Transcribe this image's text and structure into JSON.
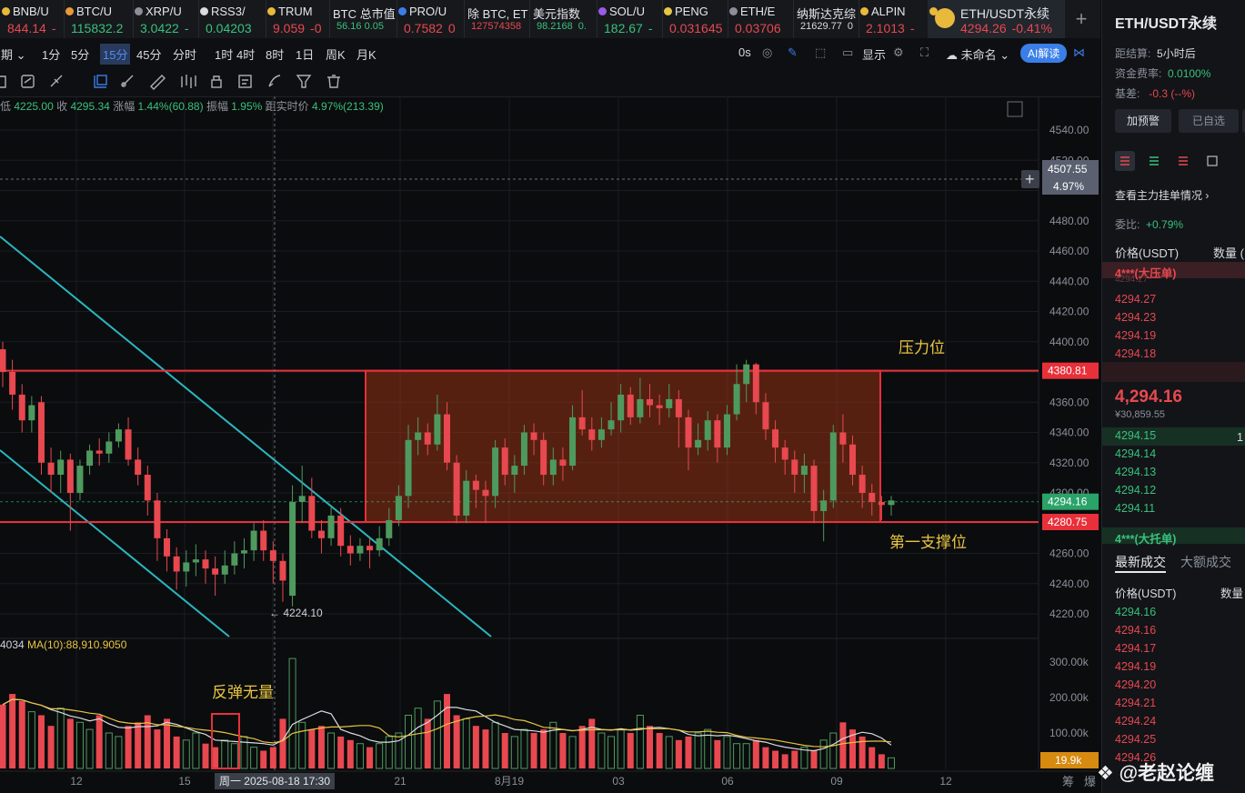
{
  "tickers": [
    {
      "name": "BNB/U",
      "price": "844.14",
      "change": "-",
      "color": "#e8484f",
      "dot": "#e8b93a"
    },
    {
      "name": "BTC/U",
      "price": "115832.2",
      "change": "",
      "color": "#39c17c",
      "dot": "#e89a3a"
    },
    {
      "name": "XRP/U",
      "price": "3.0422",
      "change": "-",
      "color": "#39c17c",
      "dot": "#8a8f98"
    },
    {
      "name": "RSS3/",
      "price": "0.04203",
      "change": "",
      "color": "#39c17c",
      "dot": "#d8dbe0"
    },
    {
      "name": "TRUM",
      "price": "9.059",
      "change": "-0",
      "color": "#e8484f",
      "dot": "#e8b93a"
    },
    {
      "name": "BTC 总市值",
      "price": "56.16 0.05",
      "change": "",
      "color": "#39c17c",
      "dot": ""
    },
    {
      "name": "PRO/U",
      "price": "0.7582",
      "change": "0",
      "color": "#e8484f",
      "dot": "#3a7ee8"
    },
    {
      "name": "除 BTC, ET",
      "price": "127574358",
      "change": "",
      "color": "#e8484f",
      "dot": ""
    },
    {
      "name": "美元指数",
      "price": "98.2168",
      "change": "0.",
      "color": "#39c17c",
      "dot": ""
    },
    {
      "name": "SOL/U",
      "price": "182.67",
      "change": "-",
      "color": "#39c17c",
      "dot": "#9a5ae8"
    },
    {
      "name": "PENG",
      "price": "0.031645",
      "change": "",
      "color": "#e8484f",
      "dot": "#e8c542"
    },
    {
      "name": "ETH/E",
      "price": "0.03706",
      "change": "",
      "color": "#e8484f",
      "dot": "#8a8f98"
    },
    {
      "name": "纳斯达克综",
      "price": "21629.77",
      "change": "0",
      "color": "#d8dbe0",
      "dot": ""
    },
    {
      "name": "ALPIN",
      "price": "2.1013",
      "change": "-",
      "color": "#e8484f",
      "dot": "#e8b93a"
    },
    {
      "name": "ETH/USDT永续",
      "price": "4294.26",
      "change": "-0.41%",
      "color": "#e8484f",
      "dot": "#e8b93a"
    }
  ],
  "timeframes": [
    "周期",
    "1分",
    "5分",
    "15分",
    "45分",
    "分时",
    "1时",
    "4时",
    "8时",
    "1日",
    "周K",
    "月K"
  ],
  "active_timeframe": "15分",
  "toolbar_right": {
    "countdown": "0s",
    "display": "显示",
    "layout_name": "未命名",
    "ai_button": "AI解读"
  },
  "info_line": {
    "low_label": "低",
    "low": "4225.00",
    "close_label": "收",
    "close": "4295.34",
    "change_label": "涨幅",
    "change": "1.44%(60.88)",
    "amplitude_label": "振幅",
    "amplitude": "1.95%",
    "distance_label": "距实时价",
    "distance": "4.97%(213.39)"
  },
  "price_tags": {
    "cross_price": "4507.55",
    "cross_pct": "4.97%",
    "resistance": "4380.81",
    "current": "4294.16",
    "support": "4280.75",
    "volume_current": "19.9k"
  },
  "annotations": {
    "resistance_label": "压力位",
    "support_label": "第一支撑位",
    "volume_note": "反弹无量",
    "low_marker": "4224.10"
  },
  "volume_info": {
    "prefix": "4034",
    "ma_text": "MA(10):88,910.9050"
  },
  "x_axis": {
    "labels": [
      "12",
      "15",
      "21",
      "8月19",
      "03",
      "06",
      "09",
      "12"
    ],
    "cursor_label": "周一 2025-08-18 17:30",
    "right_labels": [
      "筹",
      "爆"
    ]
  },
  "watermark": "@老赵论缠",
  "chart_data": {
    "type": "candlestick",
    "y_ticks": [
      4540,
      4520,
      4500,
      4480,
      4460,
      4440,
      4420,
      4400,
      4380,
      4360,
      4340,
      4320,
      4300,
      4280,
      4260,
      4240,
      4220
    ],
    "volume_ticks": [
      "300.00k",
      "200.00k",
      "100.00k"
    ],
    "resistance": 4380.81,
    "support": 4280.75,
    "current": 4294.16,
    "low": 4224.1,
    "candles": [
      [
        4395,
        4380,
        4400,
        4370
      ],
      [
        4380,
        4365,
        4388,
        4355
      ],
      [
        4365,
        4348,
        4372,
        4340
      ],
      [
        4348,
        4358,
        4364,
        4340
      ],
      [
        4360,
        4320,
        4364,
        4312
      ],
      [
        4320,
        4312,
        4330,
        4300
      ],
      [
        4312,
        4322,
        4328,
        4300
      ],
      [
        4322,
        4300,
        4326,
        4275
      ],
      [
        4300,
        4318,
        4322,
        4295
      ],
      [
        4318,
        4328,
        4332,
        4312
      ],
      [
        4328,
        4326,
        4336,
        4318
      ],
      [
        4326,
        4334,
        4340,
        4320
      ],
      [
        4334,
        4342,
        4346,
        4330
      ],
      [
        4342,
        4322,
        4350,
        4318
      ],
      [
        4322,
        4312,
        4330,
        4305
      ],
      [
        4312,
        4295,
        4318,
        4285
      ],
      [
        4295,
        4270,
        4300,
        4255
      ],
      [
        4270,
        4258,
        4276,
        4248
      ],
      [
        4258,
        4248,
        4264,
        4236
      ],
      [
        4248,
        4254,
        4262,
        4238
      ],
      [
        4254,
        4256,
        4266,
        4245
      ],
      [
        4256,
        4250,
        4262,
        4240
      ],
      [
        4250,
        4246,
        4258,
        4232
      ],
      [
        4246,
        4252,
        4262,
        4240
      ],
      [
        4252,
        4260,
        4268,
        4246
      ],
      [
        4260,
        4262,
        4270,
        4250
      ],
      [
        4262,
        4275,
        4280,
        4255
      ],
      [
        4275,
        4262,
        4282,
        4255
      ],
      [
        4262,
        4255,
        4268,
        4240
      ],
      [
        4255,
        4242,
        4260,
        4228
      ],
      [
        4232,
        4294,
        4305,
        4225
      ],
      [
        4294,
        4298,
        4318,
        4280
      ],
      [
        4298,
        4275,
        4310,
        4270
      ],
      [
        4275,
        4270,
        4282,
        4260
      ],
      [
        4270,
        4285,
        4292,
        4265
      ],
      [
        4285,
        4265,
        4290,
        4258
      ],
      [
        4265,
        4260,
        4272,
        4252
      ],
      [
        4260,
        4265,
        4270,
        4255
      ],
      [
        4265,
        4262,
        4270,
        4250
      ],
      [
        4262,
        4270,
        4278,
        4258
      ],
      [
        4270,
        4282,
        4290,
        4265
      ],
      [
        4282,
        4298,
        4305,
        4278
      ],
      [
        4298,
        4335,
        4345,
        4290
      ],
      [
        4335,
        4340,
        4350,
        4325
      ],
      [
        4340,
        4332,
        4346,
        4325
      ],
      [
        4332,
        4352,
        4365,
        4328
      ],
      [
        4352,
        4320,
        4360,
        4315
      ],
      [
        4320,
        4285,
        4325,
        4280
      ],
      [
        4285,
        4308,
        4315,
        4280
      ],
      [
        4308,
        4302,
        4312,
        4290
      ],
      [
        4302,
        4298,
        4308,
        4280
      ],
      [
        4298,
        4330,
        4335,
        4290
      ],
      [
        4330,
        4312,
        4336,
        4305
      ],
      [
        4312,
        4318,
        4325,
        4300
      ],
      [
        4318,
        4340,
        4345,
        4312
      ],
      [
        4340,
        4335,
        4346,
        4325
      ],
      [
        4335,
        4312,
        4340,
        4305
      ],
      [
        4312,
        4322,
        4330,
        4305
      ],
      [
        4322,
        4318,
        4330,
        4308
      ],
      [
        4318,
        4350,
        4358,
        4315
      ],
      [
        4350,
        4342,
        4368,
        4338
      ],
      [
        4342,
        4335,
        4350,
        4328
      ],
      [
        4335,
        4342,
        4350,
        4330
      ],
      [
        4342,
        4348,
        4360,
        4338
      ],
      [
        4348,
        4365,
        4372,
        4340
      ],
      [
        4365,
        4350,
        4370,
        4345
      ],
      [
        4350,
        4362,
        4376,
        4346
      ],
      [
        4362,
        4358,
        4372,
        4350
      ],
      [
        4358,
        4356,
        4365,
        4345
      ],
      [
        4356,
        4362,
        4372,
        4350
      ],
      [
        4362,
        4350,
        4368,
        4330
      ],
      [
        4350,
        4330,
        4355,
        4315
      ],
      [
        4330,
        4335,
        4346,
        4325
      ],
      [
        4335,
        4348,
        4354,
        4328
      ],
      [
        4348,
        4330,
        4352,
        4320
      ],
      [
        4330,
        4352,
        4358,
        4325
      ],
      [
        4352,
        4372,
        4385,
        4348
      ],
      [
        4372,
        4385,
        4388,
        4360
      ],
      [
        4385,
        4360,
        4386,
        4352
      ],
      [
        4360,
        4342,
        4366,
        4335
      ],
      [
        4342,
        4330,
        4348,
        4320
      ],
      [
        4330,
        4322,
        4335,
        4312
      ],
      [
        4322,
        4312,
        4328,
        4300
      ],
      [
        4312,
        4318,
        4326,
        4300
      ],
      [
        4318,
        4288,
        4322,
        4280
      ],
      [
        4288,
        4295,
        4302,
        4268
      ],
      [
        4295,
        4340,
        4345,
        4290
      ],
      [
        4340,
        4332,
        4352,
        4320
      ],
      [
        4332,
        4312,
        4338,
        4305
      ],
      [
        4312,
        4300,
        4318,
        4290
      ],
      [
        4300,
        4294,
        4306,
        4285
      ],
      [
        4294,
        4292,
        4298,
        4282
      ],
      [
        4292,
        4295,
        4298,
        4285
      ]
    ],
    "volumes": [
      180,
      210,
      190,
      160,
      150,
      120,
      170,
      140,
      130,
      110,
      150,
      100,
      90,
      120,
      130,
      150,
      110,
      140,
      90,
      80,
      100,
      70,
      60,
      80,
      70,
      90,
      60,
      50,
      60,
      140,
      310,
      130,
      110,
      120,
      100,
      90,
      80,
      70,
      60,
      70,
      90,
      100,
      150,
      170,
      140,
      190,
      210,
      150,
      140,
      120,
      110,
      130,
      100,
      90,
      110,
      100,
      110,
      130,
      100,
      90,
      120,
      140,
      100,
      90,
      110,
      100,
      150,
      120,
      100,
      90,
      80,
      90,
      100,
      110,
      80,
      90,
      70,
      70,
      80,
      60,
      50,
      40,
      50,
      60,
      50,
      80,
      100,
      130,
      110,
      90,
      60,
      40,
      30
    ]
  }
}
